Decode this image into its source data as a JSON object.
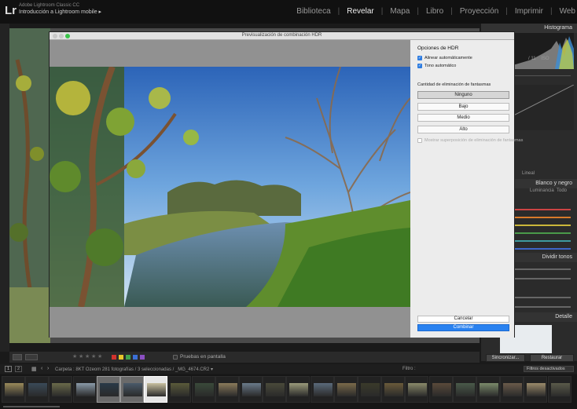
{
  "app": {
    "logo": "Lr",
    "product": "Adobe Lightroom Classic CC",
    "catalog": "Introducción a Lightroom mobile ▸"
  },
  "modules": [
    {
      "label": "Biblioteca"
    },
    {
      "label": "Revelar"
    },
    {
      "label": "Mapa"
    },
    {
      "label": "Libro"
    },
    {
      "label": "Proyección"
    },
    {
      "label": "Imprimir"
    },
    {
      "label": "Web"
    }
  ],
  "right_panel": {
    "histogram_label": "Histograma",
    "basic_tag": "Lineal",
    "hsl_header": "Blanco y negro",
    "hsl_tabs": [
      "Luminancia",
      "Todo"
    ],
    "split_header": "Dividir tonos",
    "detail_header": "Detalle",
    "sync_label": "Sincronizar...",
    "reset_label": "Restaurar"
  },
  "dialog": {
    "title": "Previsualización de combinación HDR",
    "options_heading": "Opciones de HDR",
    "auto_align": "Alinear automáticamente",
    "auto_tone": "Tono automático",
    "ghost_label": "Cantidad de eliminación de fantasmas",
    "ghost_options": [
      "Ninguno",
      "Bajo",
      "Medio",
      "Alto"
    ],
    "show_overlay": "Mostrar superposición de eliminación de fantasmas",
    "cancel": "Cancelar",
    "merge": "Combinar"
  },
  "toolbar": {
    "screen_proof": "Pruebas en pantalla"
  },
  "filmbar": {
    "page_buttons": [
      "1",
      "2"
    ],
    "folder_info": "Carpeta : 8KT Ozeom   281 fotografías / 3 seleccionadas / _MG_4674.CR2 ▾",
    "filter_label": "Filtro :",
    "filter_value": "Filtros desactivados"
  },
  "colors": {
    "accent_blue": "#2a82f0",
    "label_swatches": [
      "#d0322d",
      "#e6c52b",
      "#3fa34d",
      "#3b6fd6",
      "#8b4fc2"
    ]
  }
}
